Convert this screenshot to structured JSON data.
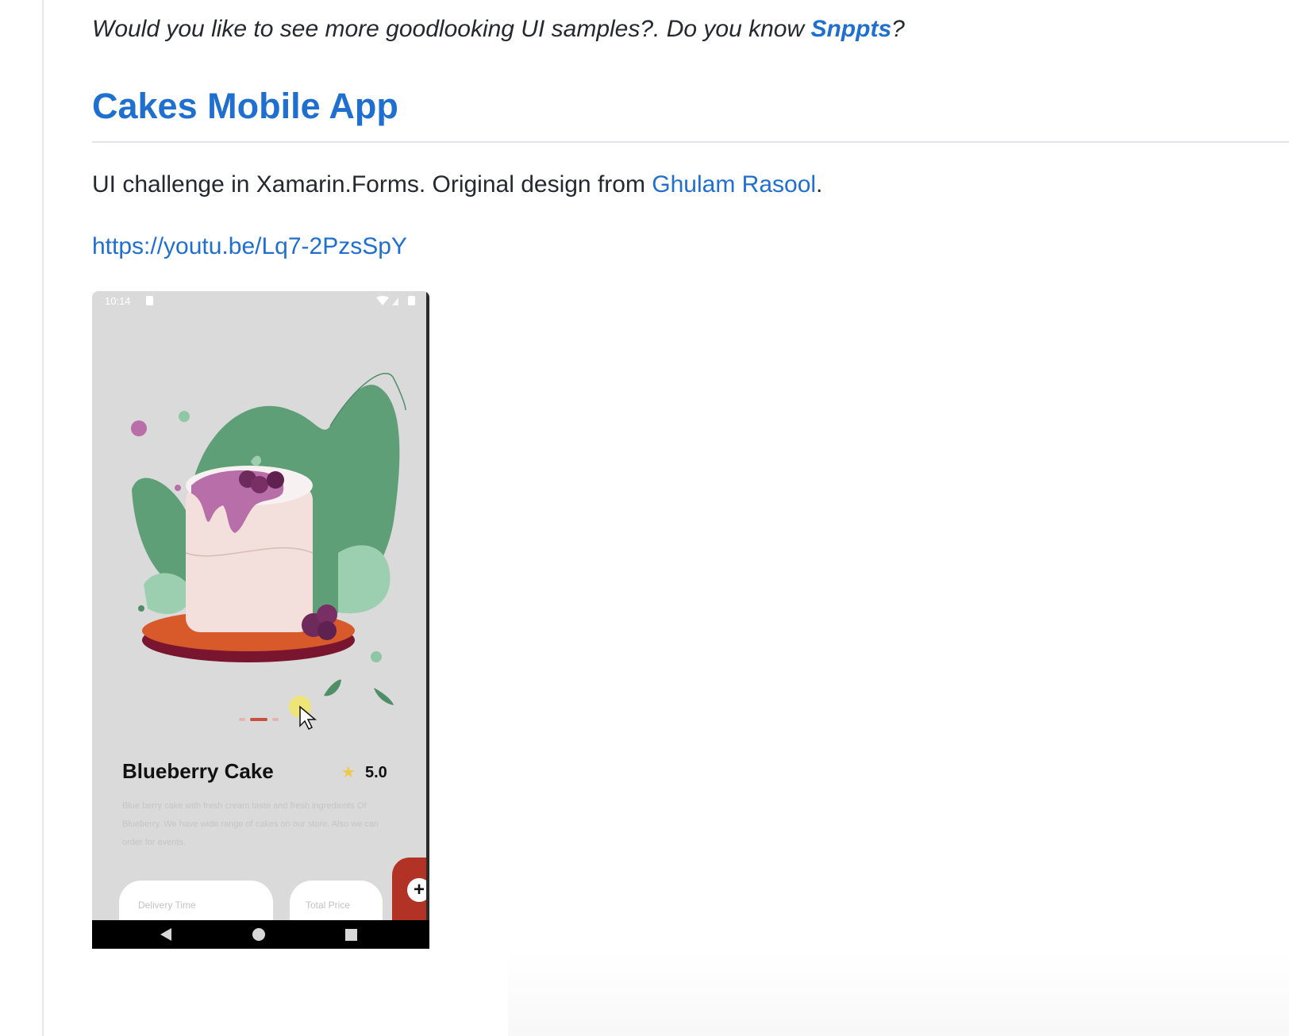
{
  "intro": {
    "text_before": "Would you like to see more goodlooking UI samples?. Do you know ",
    "link": "Snppts",
    "text_after": "?"
  },
  "section": {
    "title": "Cakes Mobile App",
    "desc_before": "UI challenge in Xamarin.Forms. Original design from ",
    "desc_link": "Ghulam Rasool",
    "desc_after": ".",
    "video_link": "https://youtu.be/Lq7-2PzsSpY"
  },
  "phone": {
    "status_time": "10:14",
    "product_name": "Blueberry Cake",
    "rating": "5.0",
    "description": "Blue berry cake with fresh cream taste and fresh ingredients Of Blueberry. We have wide range of cakes on our store. Also we can order for events.",
    "delivery_label": "Delivery Time",
    "price_label": "Total Price",
    "add_symbol": "+",
    "star_symbol": "★"
  },
  "icons": {
    "add": "plus-icon",
    "star": "star-icon",
    "back": "nav-back-icon",
    "home": "nav-home-icon",
    "recent": "nav-recent-icon"
  },
  "colors": {
    "link": "#1f6fd1",
    "accent": "#b23325",
    "leaf": "#5f9f78",
    "glaze": "#b86ea8",
    "plate": "#d85a2a"
  }
}
